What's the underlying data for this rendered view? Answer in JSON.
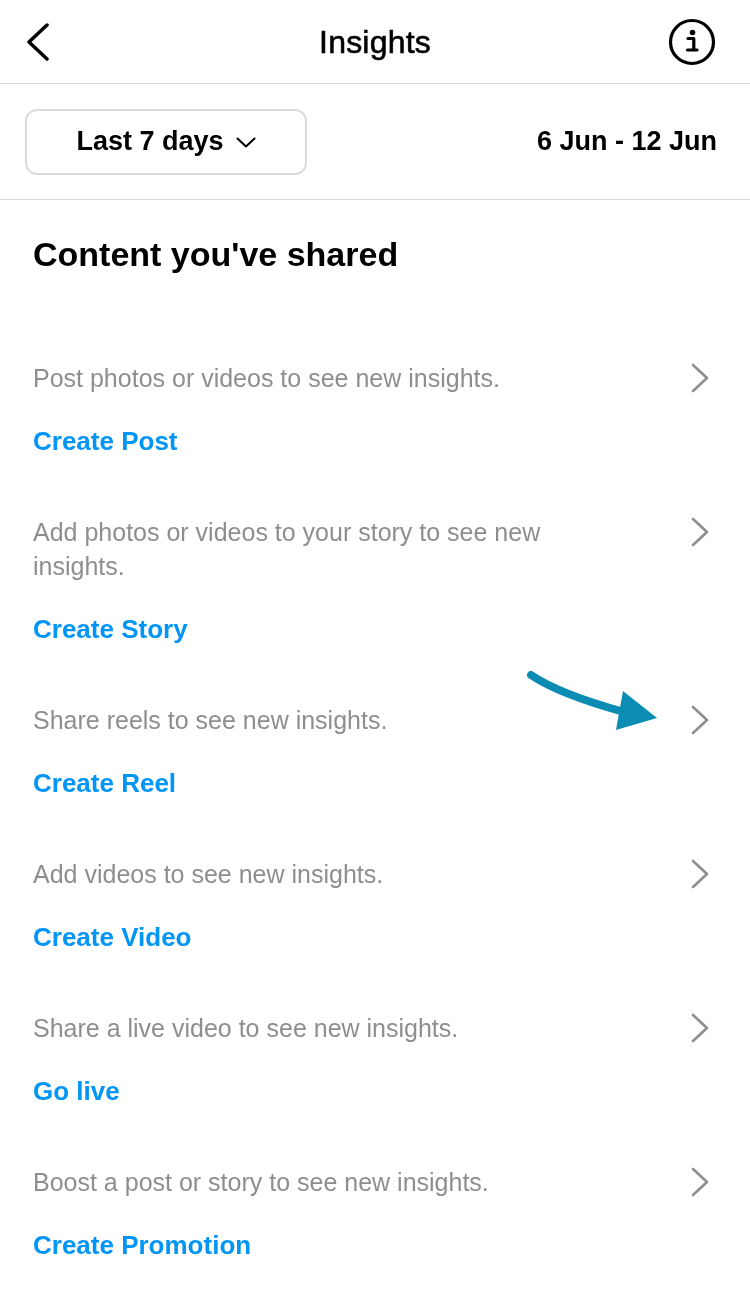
{
  "header": {
    "title": "Insights"
  },
  "filter": {
    "range_dropdown": "Last 7 days",
    "date_range": "6 Jun - 12 Jun"
  },
  "section": {
    "title": "Content you've shared",
    "items": [
      {
        "description": "Post photos or videos to see new insights.",
        "action": "Create Post",
        "annotated": false
      },
      {
        "description": "Add photos or videos to your story to see new insights.",
        "action": "Create Story",
        "annotated": false
      },
      {
        "description": "Share reels to see new insights.",
        "action": "Create Reel",
        "annotated": true
      },
      {
        "description": "Add videos to see new insights.",
        "action": "Create Video",
        "annotated": false
      },
      {
        "description": "Share a live video to see new insights.",
        "action": "Go live",
        "annotated": false
      },
      {
        "description": "Boost a post or story to see new insights.",
        "action": "Create Promotion",
        "annotated": false
      }
    ]
  }
}
